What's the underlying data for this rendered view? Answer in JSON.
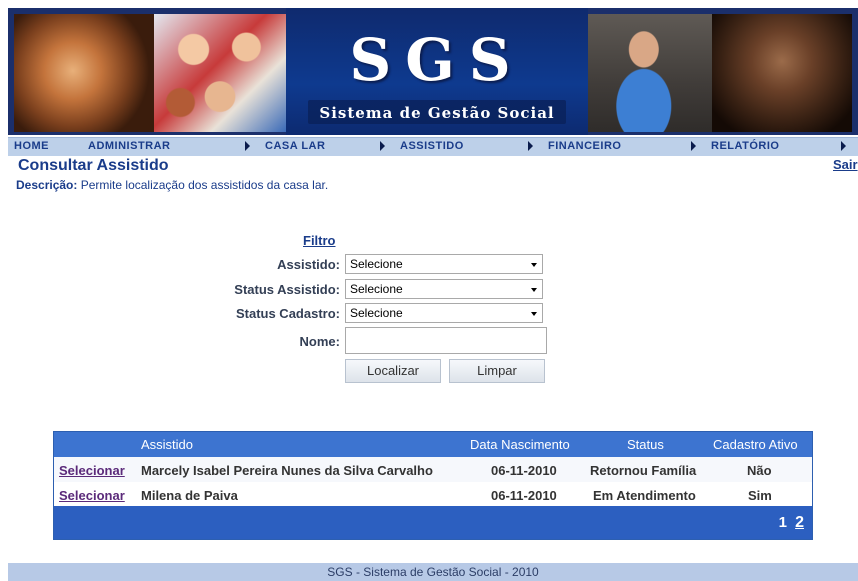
{
  "banner": {
    "logo": "SGS",
    "subtitle": "Sistema de Gestão Social"
  },
  "menu": [
    {
      "label": "HOME",
      "has_arrow": false
    },
    {
      "label": "ADMINISTRAR",
      "has_arrow": true
    },
    {
      "label": "CASA LAR",
      "has_arrow": true
    },
    {
      "label": "ASSISTIDO",
      "has_arrow": true
    },
    {
      "label": "FINANCEIRO",
      "has_arrow": true
    },
    {
      "label": "RELATÓRIO",
      "has_arrow": true
    }
  ],
  "page": {
    "title": "Consultar Assistido",
    "logout": "Sair",
    "description_label": "Descrição:",
    "description_text": "Permite localização dos assistidos da casa lar."
  },
  "filter": {
    "link": "Filtro",
    "assistido_label": "Assistido:",
    "assistido_value": "Selecione",
    "status_assistido_label": "Status Assistido:",
    "status_assistido_value": "Selecione",
    "status_cadastro_label": "Status Cadastro:",
    "status_cadastro_value": "Selecione",
    "nome_label": "Nome:",
    "nome_value": "",
    "localizar": "Localizar",
    "limpar": "Limpar"
  },
  "table": {
    "headers": [
      "",
      "Assistido",
      "Data Nascimento",
      "Status",
      "Cadastro Ativo"
    ],
    "rows": [
      {
        "action": "Selecionar",
        "assistido": "Marcely Isabel Pereira Nunes da Silva Carvalho",
        "data_nascimento": "06-11-2010",
        "status": "Retornou Família",
        "cadastro_ativo": "Não"
      },
      {
        "action": "Selecionar",
        "assistido": "Milena de Paiva",
        "data_nascimento": "06-11-2010",
        "status": "Em Atendimento",
        "cadastro_ativo": "Sim"
      }
    ],
    "pages": [
      "1",
      "2"
    ],
    "current_page": "2"
  },
  "footer": {
    "text": "SGS - Sistema de Gestão Social - 2010"
  },
  "colors": {
    "header_blue": "#1a3c8a",
    "table_header": "#3d74d0",
    "table_footer": "#2c5fc0",
    "menu_bar": "#bdd0e9",
    "footer_bar": "#b7c9e6"
  }
}
